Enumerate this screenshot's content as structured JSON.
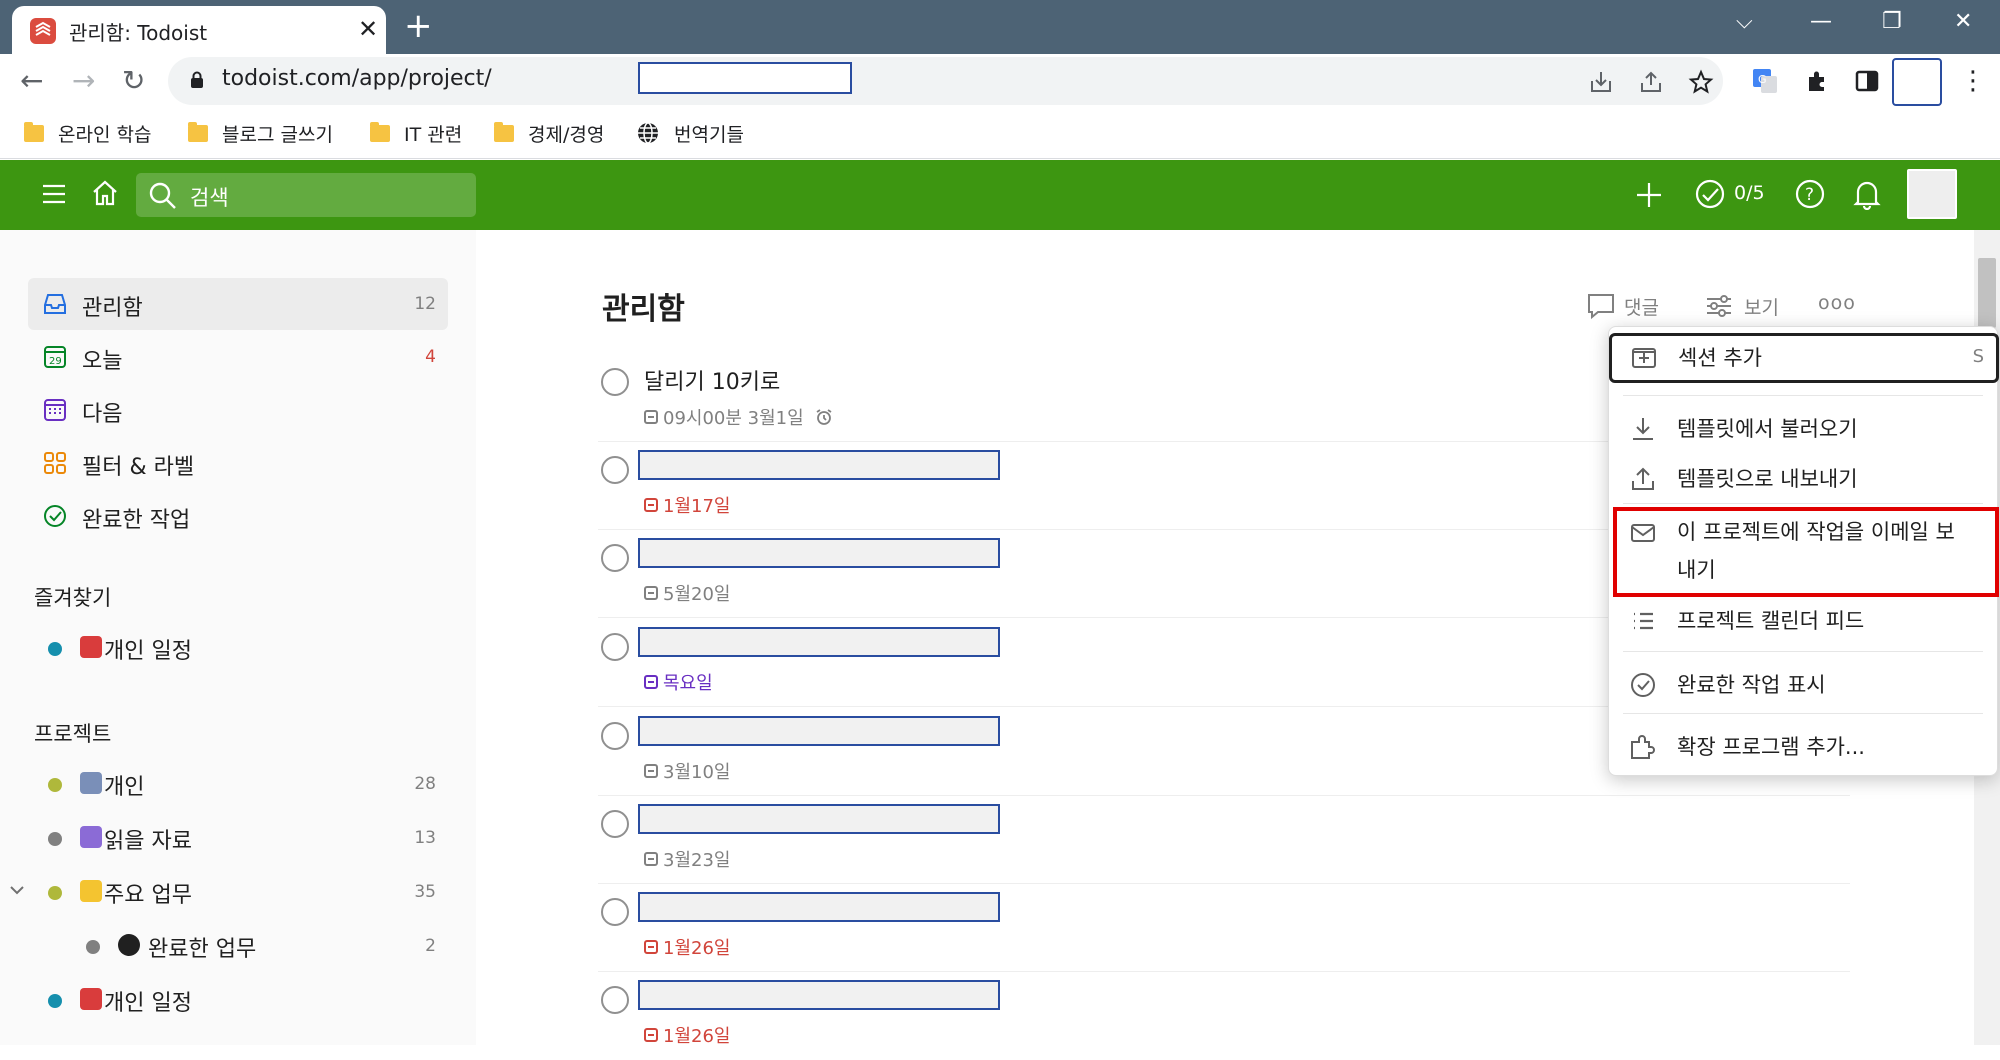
{
  "browser": {
    "tab_title": "관리함: Todoist",
    "url": "todoist.com/app/project/",
    "bookmarks": [
      "온라인 학습",
      "블로그 글쓰기",
      "IT 관련",
      "경제/경영",
      "번역기들"
    ]
  },
  "header": {
    "search_placeholder": "검색",
    "karma": "0/5"
  },
  "sidebar": {
    "nav": [
      {
        "label": "관리함",
        "count": "12"
      },
      {
        "label": "오늘",
        "count": "4"
      },
      {
        "label": "다음",
        "count": ""
      },
      {
        "label": "필터 & 라벨",
        "count": ""
      },
      {
        "label": "완료한 작업",
        "count": ""
      }
    ],
    "favorites_title": "즐겨찾기",
    "favorites": [
      {
        "label": "개인 일정",
        "count": ""
      }
    ],
    "projects_title": "프로젝트",
    "projects": [
      {
        "label": "개인",
        "count": "28"
      },
      {
        "label": "읽을 자료",
        "count": "13"
      },
      {
        "label": "주요 업무",
        "count": "35"
      },
      {
        "label": "완료한 업무",
        "count": "2"
      },
      {
        "label": "개인 일정",
        "count": ""
      }
    ]
  },
  "main": {
    "title": "관리함",
    "actions": {
      "comment": "댓글",
      "view": "보기",
      "more": "ooo"
    },
    "tasks": [
      {
        "title": "달리기 10키로",
        "due": "09시00분 3월1일"
      },
      {
        "title": "",
        "due": "1월17일"
      },
      {
        "title": "",
        "due": "5월20일"
      },
      {
        "title": "",
        "due": "목요일"
      },
      {
        "title": "",
        "due": "3월10일"
      },
      {
        "title": "",
        "due": "3월23일"
      },
      {
        "title": "",
        "due": "1월26일"
      },
      {
        "title": "",
        "due": "1월26일"
      }
    ]
  },
  "menu": {
    "add_section": "섹션 추가",
    "add_section_shortcut": "S",
    "import_template": "템플릿에서 불러오기",
    "export_template": "템플릿으로 내보내기",
    "email_tasks_line1": "이 프로젝트에 작업을 이메일 보",
    "email_tasks_line2": "내기",
    "calendar_feed": "프로젝트 캘린더 피드",
    "show_completed": "완료한 작업 표시",
    "add_extension": "확장 프로그램 추가..."
  },
  "colors": {
    "brand_green": "#3d9611",
    "todoist_red": "#db4c3f",
    "highlight_red": "#e00000"
  }
}
